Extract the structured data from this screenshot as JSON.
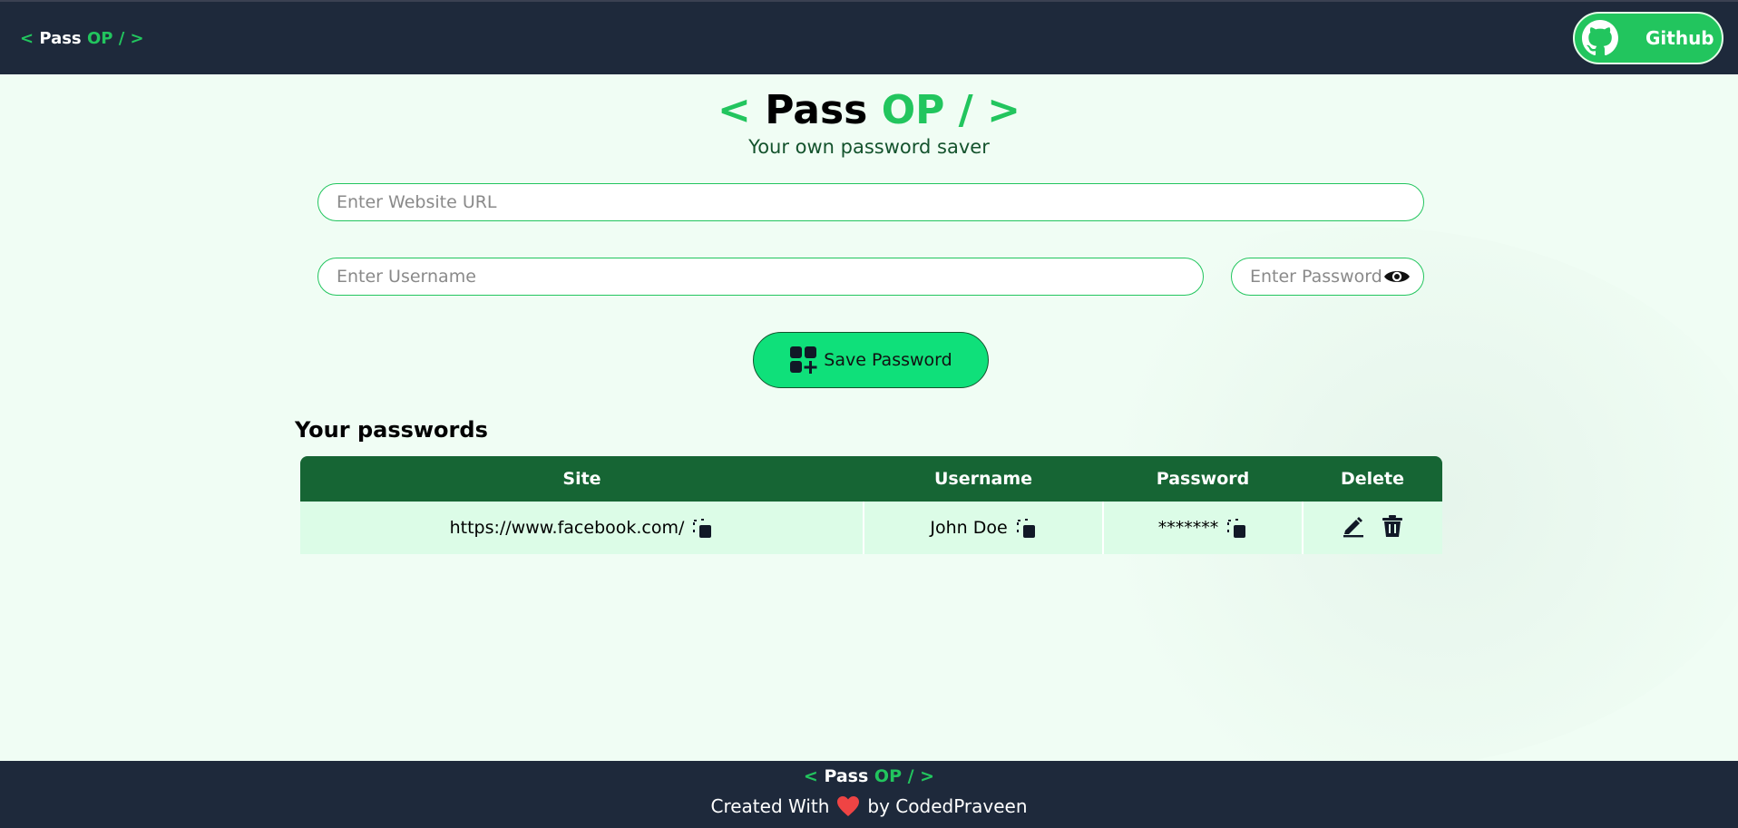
{
  "navbar": {
    "logo": {
      "open": "< ",
      "pass": "Pass",
      "op": "OP",
      "close": " / >"
    },
    "github_label": "Github"
  },
  "hero": {
    "logo": {
      "open": "< ",
      "pass": "Pass",
      "op": "OP",
      "close": " / >"
    },
    "subtitle": "Your own password saver"
  },
  "form": {
    "url_placeholder": "Enter Website URL",
    "username_placeholder": "Enter Username",
    "password_placeholder": "Enter Password",
    "save_label": "Save Password"
  },
  "passwords": {
    "title": "Your passwords",
    "columns": [
      "Site",
      "Username",
      "Password",
      "Delete"
    ],
    "rows": [
      {
        "site": "https://www.facebook.com/",
        "username": "John Doe",
        "password": "*******"
      }
    ]
  },
  "footer": {
    "logo": {
      "open": "< ",
      "pass": "Pass",
      "op": "OP",
      "close": " / >"
    },
    "created_with": "Created With",
    "by": "by CodedPraveen"
  },
  "colors": {
    "accent": "#22c55e",
    "dark": "#1e293b",
    "table_header": "#166534",
    "table_row": "#dcfce7",
    "save_button": "#0fe07a",
    "heart": "#ef4444"
  },
  "icons": {
    "github": "github-icon",
    "eye": "eye-icon",
    "add": "add-grid-icon",
    "copy": "copy-icon",
    "edit": "edit-icon",
    "trash": "trash-icon",
    "heart": "heart-icon"
  }
}
